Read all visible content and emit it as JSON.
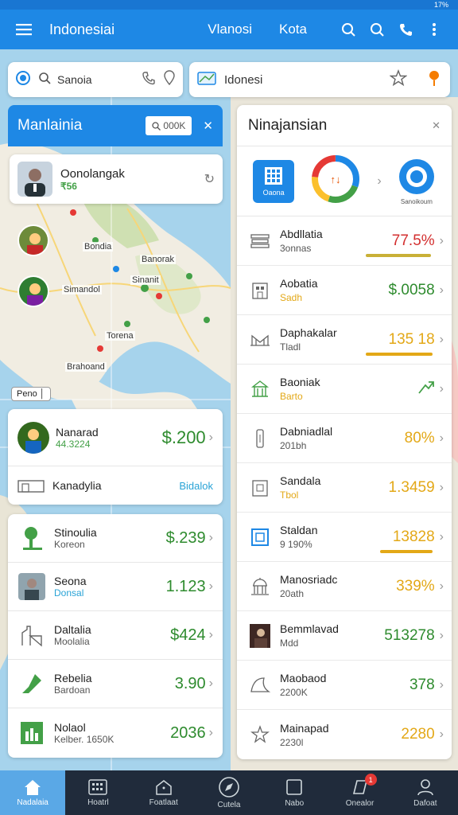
{
  "status_bar": {
    "time": "",
    "right": "17%"
  },
  "app_bar": {
    "title": "Indonesiai",
    "nav_links": [
      "Vlanosi",
      "Kota"
    ]
  },
  "search": {
    "text": "Sanoia"
  },
  "destination": {
    "text": "Idonesi"
  },
  "left_panel": {
    "title": "Manlainia",
    "mini_search": "000K",
    "profile": {
      "name": "Oonolangak",
      "sub": "₹56"
    },
    "map_labels": [
      "Bondia",
      "Banorak",
      "Simandol",
      "Sinanit",
      "Torena",
      "Brahoand"
    ],
    "scale": "Peno",
    "card1": [
      {
        "label": "Nanarad",
        "sub": "44.3224",
        "value": "$.200"
      },
      {
        "label": "Kanadylia",
        "link": "Bidalok"
      }
    ],
    "card2": [
      {
        "label": "Stinoulia",
        "sub": "Koreon",
        "value": "$.239"
      },
      {
        "label": "Seona",
        "sub": "Donsal",
        "value": "1.123"
      },
      {
        "label": "Daltalia",
        "sub": "Moolalia",
        "value": "$424"
      },
      {
        "label": "Rebelia",
        "sub": "Bardoan",
        "value": "3.90"
      },
      {
        "label": "Nolaol",
        "sub": "Kelber. 1650K",
        "value": "2036"
      }
    ]
  },
  "right_panel": {
    "title": "Ninajansian",
    "top_icons": [
      {
        "label": "Oaona"
      },
      {
        "label": ""
      },
      {
        "label": "Sanoikoum"
      }
    ],
    "rows": [
      {
        "label": "Abdllatia",
        "sub": "3onnas",
        "value": "77.5%",
        "value_color": "#d32f2f",
        "underline": "#c9b037",
        "icon": "books-icon"
      },
      {
        "label": "Aobatia",
        "sub": "Sadh",
        "value": "$.0058",
        "value_color": "#2e8b2e",
        "underline": "",
        "icon": "building-icon"
      },
      {
        "label": "Daphakalar",
        "sub": "Tladl",
        "value": "135 18",
        "value_color": "#e3a817",
        "underline": "#e3a817",
        "icon": "bridge-icon"
      },
      {
        "label": "Baoniak",
        "sub": "Barto",
        "value": "",
        "value_color": "#2e8b2e",
        "underline": "",
        "icon": "temple-icon"
      },
      {
        "label": "Dabniadlal",
        "sub": "201bh",
        "value": "80%",
        "value_color": "#e3a817",
        "underline": "",
        "icon": "tower-icon"
      },
      {
        "label": "Sandala",
        "sub": "Tbol",
        "value": "1.3459",
        "value_color": "#e3a817",
        "underline": "",
        "icon": "monument-icon"
      },
      {
        "label": "Staldan",
        "sub": "9 190%",
        "value": "13828",
        "value_color": "#e3a817",
        "underline": "#e3a817",
        "icon": "frame-icon"
      },
      {
        "label": "Manosriadc",
        "sub": "20ath",
        "value": "339%",
        "value_color": "#e3a817",
        "underline": "",
        "icon": "dome-icon"
      },
      {
        "label": "Bemmlavad",
        "sub": "Mdd",
        "value": "513278",
        "value_color": "#2e8b2e",
        "underline": "",
        "icon": "portrait-icon"
      },
      {
        "label": "Maobaod",
        "sub": "2200K",
        "value": "378",
        "value_color": "#2e8b2e",
        "underline": "",
        "icon": "leaf-icon"
      },
      {
        "label": "Mainapad",
        "sub": "2230l",
        "value": "2280",
        "value_color": "#e3a817",
        "underline": "",
        "icon": "star-icon"
      }
    ]
  },
  "bottom_nav": [
    {
      "label": "Nadalaia",
      "icon": "home-icon",
      "active": true
    },
    {
      "label": "Hoatrl",
      "icon": "grid-icon"
    },
    {
      "label": "Foatlaat",
      "icon": "house-icon"
    },
    {
      "label": "Cutela",
      "icon": "compass-icon"
    },
    {
      "label": "Nabo",
      "icon": "square-icon"
    },
    {
      "label": "Onealor",
      "icon": "note-icon",
      "badge": "1"
    },
    {
      "label": "Dafoat",
      "icon": "user-icon"
    }
  ]
}
